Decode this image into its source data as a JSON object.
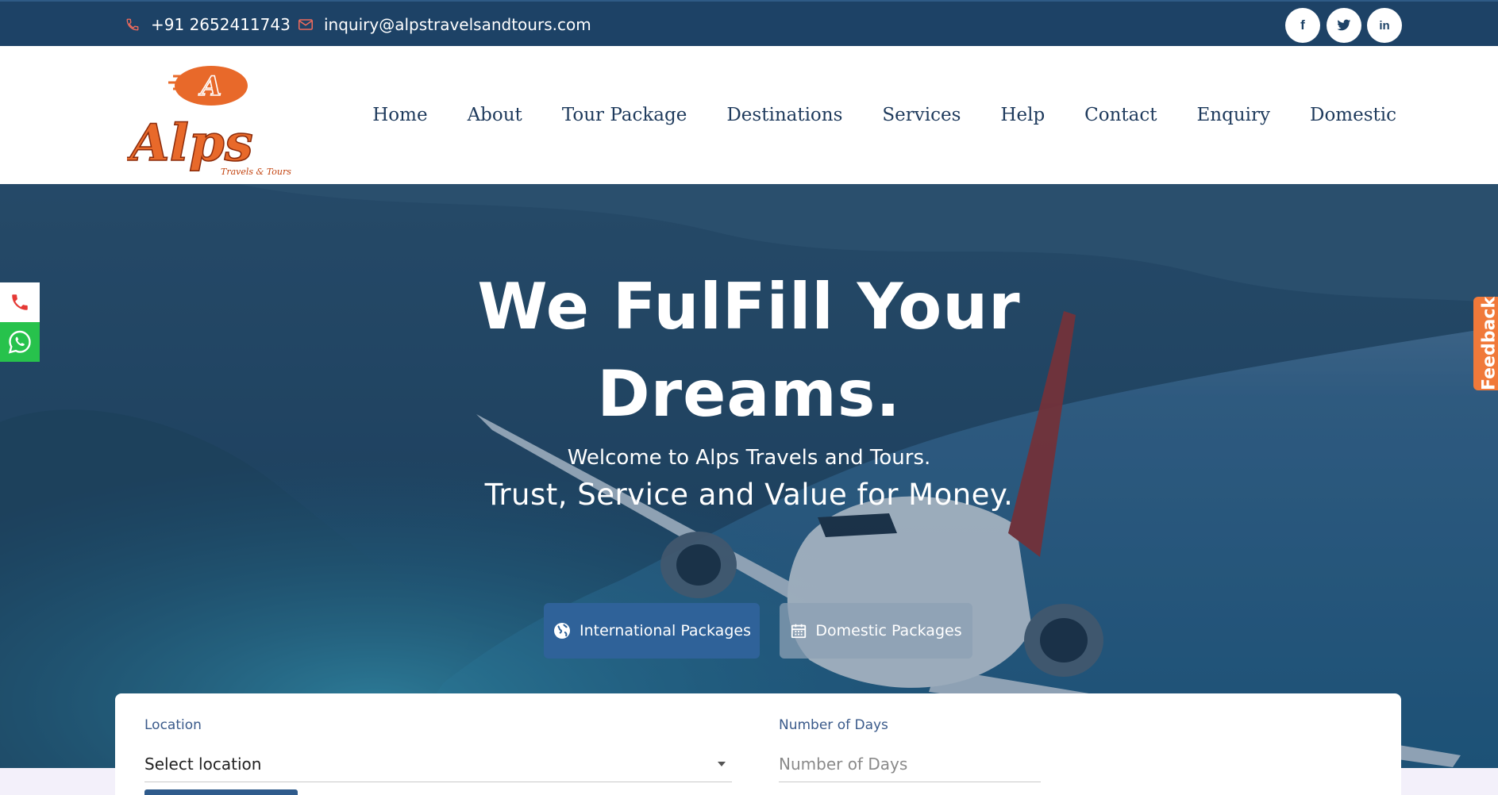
{
  "topbar": {
    "phone": "+91 2652411743",
    "email": "inquiry@alpstravelsandtours.com",
    "social": [
      {
        "name": "facebook-icon",
        "glyph": "f"
      },
      {
        "name": "twitter-icon",
        "glyph": "t"
      },
      {
        "name": "linkedin-icon",
        "glyph": "in"
      }
    ]
  },
  "logo": {
    "mark": "A",
    "name": "Alps",
    "tagline": "Travels & Tours"
  },
  "nav": {
    "items": [
      {
        "label": "Home"
      },
      {
        "label": "About"
      },
      {
        "label": "Tour Package"
      },
      {
        "label": "Destinations"
      },
      {
        "label": "Services"
      },
      {
        "label": "Help"
      },
      {
        "label": "Contact"
      },
      {
        "label": "Enquiry"
      },
      {
        "label": "Domestic"
      }
    ]
  },
  "hero": {
    "headline_line1": "We FulFill Your",
    "headline_line2": "Dreams.",
    "welcome": "Welcome to Alps Travels and Tours.",
    "tagline": "Trust, Service and Value for Money.",
    "buttons": {
      "international": "International Packages",
      "domestic": "Domestic Packages"
    }
  },
  "feedback": {
    "label": "Feedback"
  },
  "search": {
    "location_label": "Location",
    "location_value": "Select location",
    "days_label": "Number of Days",
    "days_placeholder": "Number of Days"
  },
  "colors": {
    "topbar": "#1d4266",
    "brand_orange": "#e8692a",
    "primary_button": "#2f6299",
    "whatsapp": "#27c24c",
    "feedback": "#f0793a"
  }
}
